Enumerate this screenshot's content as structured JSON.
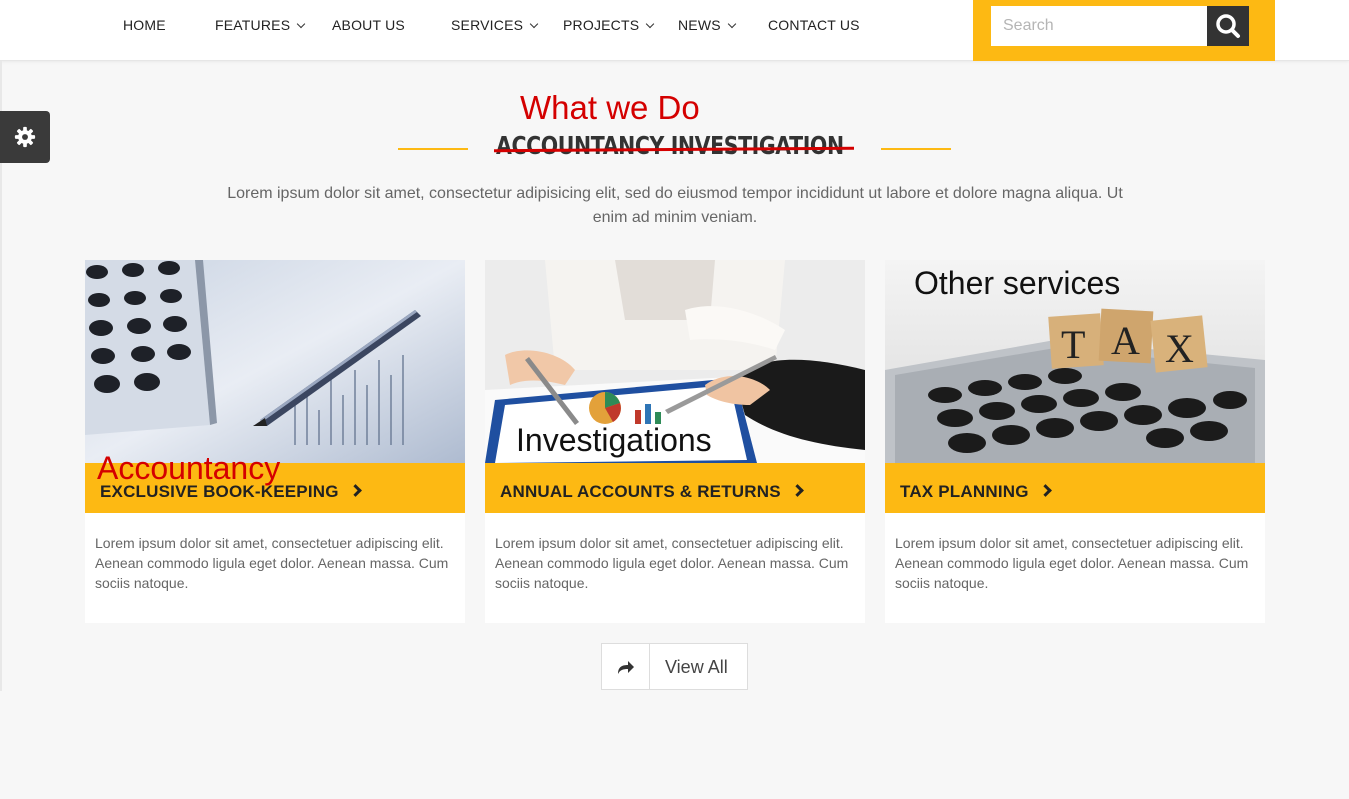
{
  "nav": {
    "items": [
      {
        "label": "HOME",
        "has_dropdown": false
      },
      {
        "label": "FEATURES",
        "has_dropdown": true
      },
      {
        "label": "ABOUT US",
        "has_dropdown": false
      },
      {
        "label": "SERVICES",
        "has_dropdown": true
      },
      {
        "label": "PROJECTS",
        "has_dropdown": true
      },
      {
        "label": "NEWS",
        "has_dropdown": true
      },
      {
        "label": "CONTACT US",
        "has_dropdown": false
      }
    ],
    "search": {
      "placeholder": "Search",
      "icon": "search-icon"
    }
  },
  "settings": {
    "icon": "gear-icon"
  },
  "section": {
    "annotation": "What we Do",
    "title": "ACCOUNTANCY INVESTIGATION",
    "intro": "Lorem ipsum dolor sit amet, consectetur adipisicing elit, sed do eiusmod tempor incididunt ut labore et dolore magna aliqua. Ut enim ad minim veniam."
  },
  "cards": [
    {
      "overlay": "Accountancy",
      "bar_label": "EXCLUSIVE BOOK-KEEPING",
      "text": "Lorem ipsum dolor sit amet, consectetuer adipiscing elit. Aenean commodo ligula eget dolor. Aenean massa. Cum sociis natoque."
    },
    {
      "overlay": "Investigations",
      "bar_label": "ANNUAL ACCOUNTS & RETURNS",
      "text": "Lorem ipsum dolor sit amet, consectetuer adipiscing elit. Aenean commodo ligula eget dolor. Aenean massa. Cum sociis natoque."
    },
    {
      "overlay": "Other services",
      "bar_label": "TAX PLANNING",
      "text": "Lorem ipsum dolor sit amet, consectetuer adipiscing elit. Aenean commodo ligula eget dolor. Aenean massa. Cum sociis natoque.",
      "image_text": [
        "T",
        "A",
        "X"
      ]
    }
  ],
  "view_all": {
    "label": "View All",
    "icon": "share-arrow-icon"
  },
  "colors": {
    "accent": "#fdb913",
    "annotation_red": "#d40000",
    "dark": "#333333"
  }
}
